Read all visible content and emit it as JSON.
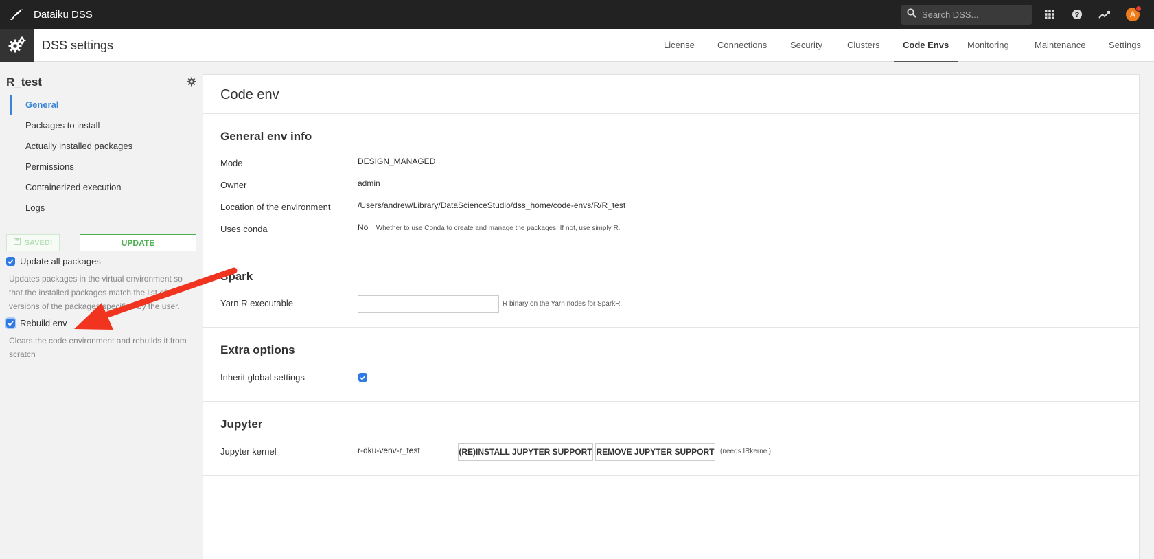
{
  "topbar": {
    "app_title": "Dataiku DSS",
    "search_placeholder": "Search DSS...",
    "avatar_initial": "A"
  },
  "header": {
    "page_title": "DSS settings",
    "tabs": [
      {
        "label": "License"
      },
      {
        "label": "Connections"
      },
      {
        "label": "Security"
      },
      {
        "label": "Clusters"
      },
      {
        "label": "Code Envs",
        "active": true
      },
      {
        "label": "Monitoring"
      },
      {
        "label": "Maintenance"
      },
      {
        "label": "Settings"
      }
    ]
  },
  "sidebar": {
    "env_name": "R_test",
    "items": [
      {
        "label": "General",
        "active": true
      },
      {
        "label": "Packages to install"
      },
      {
        "label": "Actually installed packages"
      },
      {
        "label": "Permissions"
      },
      {
        "label": "Containerized execution"
      },
      {
        "label": "Logs"
      }
    ],
    "saved_label": "SAVED!",
    "update_label": "UPDATE",
    "update_all": {
      "label": "Update all packages",
      "checked": true,
      "help": "Updates packages in the virtual environment so that the installed packages match the list of versions of the packages specified by the user."
    },
    "rebuild": {
      "label": "Rebuild env",
      "checked": true,
      "help": "Clears the code environment and rebuilds it from scratch"
    }
  },
  "main": {
    "title": "Code env",
    "general": {
      "title": "General env info",
      "mode_label": "Mode",
      "mode_value": "DESIGN_MANAGED",
      "owner_label": "Owner",
      "owner_value": "admin",
      "location_label": "Location of the environment",
      "location_value": "/Users/andrew/Library/DataScienceStudio/dss_home/code-envs/R/R_test",
      "conda_label": "Uses conda",
      "conda_value": "No",
      "conda_hint": "Whether to use Conda to create and manage the packages. If not, use simply R."
    },
    "spark": {
      "title": "Spark",
      "yarn_label": "Yarn R executable",
      "yarn_value": "",
      "yarn_hint": "R binary on the Yarn nodes for SparkR"
    },
    "extra": {
      "title": "Extra options",
      "inherit_label": "Inherit global settings",
      "inherit_checked": true
    },
    "jupyter": {
      "title": "Jupyter",
      "kernel_label": "Jupyter kernel",
      "kernel_value": "r-dku-venv-r_test",
      "install_label": "(RE)INSTALL JUPYTER SUPPORT",
      "remove_label": "REMOVE JUPYTER SUPPORT",
      "note": "(needs IRkernel)"
    }
  },
  "colors": {
    "topbar": "#222222",
    "accent_blue": "#3a86d6",
    "update_green": "#4caf50",
    "annotation_red": "#f0341f"
  },
  "icons": [
    "dataiku-bird-icon",
    "search-icon",
    "apps-grid-icon",
    "help-icon",
    "trending-icon",
    "gear-icon",
    "save-icon",
    "checkmark-icon",
    "annotation-arrow"
  ]
}
